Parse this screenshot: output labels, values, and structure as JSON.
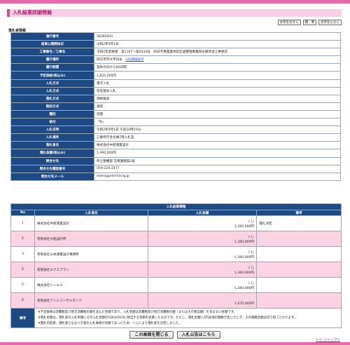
{
  "title": "入札結果詳細情報",
  "font_buttons": [
    "文字を大きく",
    "標　準",
    "文字を小さく"
  ],
  "section_label": "落札者情報",
  "info_rows": [
    {
      "label": "施行番号",
      "value": "58280341"
    },
    {
      "label": "結果公開開始日",
      "value": "令和2年9月1日"
    },
    {
      "label": "工事番号／工事名",
      "value": "令和2年度委補　第1197〜第2034号　四日市東農業地区区画整理事業排水路改良工事委託"
    },
    {
      "label": "履行場所",
      "value": "四日市市大字日永",
      "link": "GIS情報表示"
    },
    {
      "label": "履行期間",
      "value": "契約の日から60日間"
    },
    {
      "label": "予定価格(税込み)",
      "value": "1,820,200円"
    },
    {
      "label": "入札方式",
      "value": "電子入札"
    },
    {
      "label": "入札方式",
      "value": "指名競争入札"
    },
    {
      "label": "落札方式",
      "value": "価格競争"
    },
    {
      "label": "契約方式",
      "value": "通常"
    },
    {
      "label": "種別",
      "value": "測量"
    },
    {
      "label": "格付",
      "value": "「B」"
    },
    {
      "label": "入札日時",
      "value": "令和2年9月1日 午前10時15分"
    },
    {
      "label": "入札場所",
      "value": "三重県庁舎北棟7階入札室"
    },
    {
      "label": "落札者名",
      "value": "株式会社中部測量設計"
    },
    {
      "label": "落札金額(税込み)",
      "value": "1,490,000円"
    },
    {
      "label": "問合せ先",
      "value": "県土整備部 営繕課建築2班"
    },
    {
      "label": "問合せ先電話番号",
      "value": "059-224-2477"
    },
    {
      "label": "問合せ先メール",
      "value": "eizen@pref.mie.lg.jp"
    }
  ],
  "results": {
    "caption": "入札結果情報",
    "headers": {
      "no": "No",
      "name": "入札者名",
      "amount": "入札金額",
      "remarks": "備考"
    },
    "rows": [
      {
        "no": "1",
        "name": "株式会社中部測量設計",
        "lottery": "くじ",
        "amount": "1,360,000円",
        "remarks": "落札決定",
        "pink": false
      },
      {
        "no": "2",
        "name": "有限会社大船設計所",
        "lottery": "くじ",
        "amount": "1,360,000円",
        "remarks": "",
        "pink": true
      },
      {
        "no": "3",
        "name": "有限会社山本測量設計事務所",
        "lottery": "くじ",
        "amount": "1,360,000円",
        "remarks": "",
        "pink": false
      },
      {
        "no": "4",
        "name": "有限会社エクスプラン",
        "lottery": "くじ",
        "amount": "1,360,000円",
        "remarks": "",
        "pink": true
      },
      {
        "no": "5",
        "name": "株式会社シーエス",
        "lottery": "くじ",
        "amount": "1,360,000円",
        "remarks": "",
        "pink": false
      },
      {
        "no": "6",
        "name": "有限会社アイルコンサルタンツ",
        "lottery": "",
        "amount": "1,670,000円",
        "remarks": "",
        "pink": true
      }
    ],
    "note_label": "備考",
    "notes": [
      "※予定価格は消費税及び地方消費税の額を含んだ金額であり、入札金額は消費税及び地方消費税の額（またはその相当額）を含まない金額です。",
      "※落札金額は、落札者の入札金額にその入札金額の100分の10に相当する金額を加算したものです。ただし、落札金額に1円未満の端数が生じたとき、その端数金額は切り捨てとなります。",
      "※開札の結果、落札者となるべき者の入札価格が同額であったため、くじにより落札者を決定しました。"
    ]
  },
  "footer_buttons": {
    "close": "この画面を閉じる",
    "notice": "入札公告はこちら"
  },
  "pagetop": "↑ページトップへ"
}
